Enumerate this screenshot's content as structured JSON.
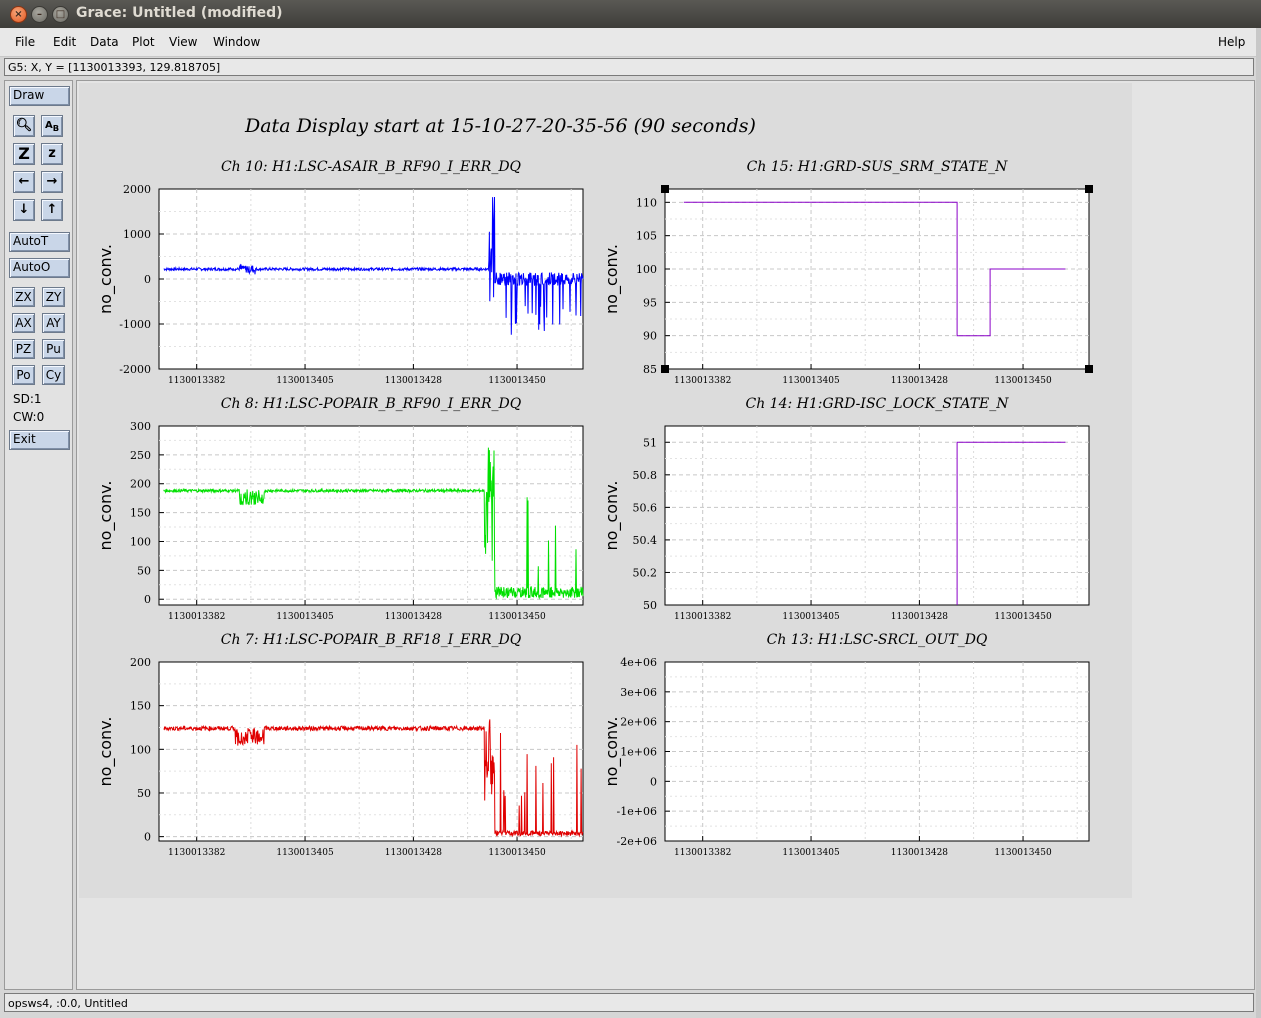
{
  "window": {
    "title": "Grace: Untitled (modified)",
    "close": "×",
    "minimize": "–",
    "maximize": "□"
  },
  "menubar": {
    "file": "File",
    "edit": "Edit",
    "data": "Data",
    "plot": "Plot",
    "view": "View",
    "window": "Window",
    "help": "Help"
  },
  "locator": "G5: X, Y = [1130013393, 129.818705]",
  "toolbar": {
    "draw": "Draw",
    "autot": "AutoT",
    "autoo": "AutoO",
    "zx": "ZX",
    "zy": "ZY",
    "ax": "AX",
    "ay": "AY",
    "pz": "PZ",
    "pu": "Pu",
    "po": "Po",
    "cy": "Cy",
    "sd": "SD:1",
    "cw": "CW:0",
    "exit": "Exit"
  },
  "status": "opsws4, :0.0, Untitled",
  "page_title": "Data Display start at 15-10-27-20-35-56 (90 seconds)",
  "chart_data": [
    {
      "type": "line",
      "title": "Ch 10: H1:LSC-ASAIR_B_RF90_I_ERR_DQ",
      "ylabel": "no_conv.",
      "color": "#0000ff",
      "ylim": [
        -2000,
        2000
      ],
      "yticks": [
        "2000",
        "1000",
        "0",
        "-1000",
        "-2000"
      ],
      "xticks": [
        "1130013382",
        "1130013405",
        "1130013428",
        "1130013450"
      ]
    },
    {
      "type": "line",
      "title": "Ch 15: H1:GRD-SUS_SRM_STATE_N",
      "ylabel": "no_conv.",
      "color": "#8a00c8",
      "ylim": [
        85,
        112
      ],
      "yticks": [
        "110",
        "105",
        "100",
        "95",
        "90",
        "85"
      ],
      "xticks": [
        "1130013382",
        "1130013405",
        "1130013428",
        "1130013450"
      ],
      "x": [
        1130013378,
        1130013436,
        1130013436,
        1130013443,
        1130013443,
        1130013459
      ],
      "y": [
        110,
        110,
        90,
        90,
        100,
        100
      ]
    },
    {
      "type": "line",
      "title": "Ch 8: H1:LSC-POPAIR_B_RF90_I_ERR_DQ",
      "ylabel": "no_conv.",
      "color": "#00e000",
      "ylim": [
        -10,
        300
      ],
      "yticks": [
        "300",
        "250",
        "200",
        "150",
        "100",
        "50",
        "0"
      ],
      "xticks": [
        "1130013382",
        "1130013405",
        "1130013428",
        "1130013450"
      ]
    },
    {
      "type": "line",
      "title": "Ch 14: H1:GRD-ISC_LOCK_STATE_N",
      "ylabel": "no_conv.",
      "color": "#8a00c8",
      "ylim": [
        50,
        51.1
      ],
      "yticks": [
        "51",
        "50.8",
        "50.6",
        "50.4",
        "50.2",
        "50"
      ],
      "xticks": [
        "1130013382",
        "1130013405",
        "1130013428",
        "1130013450"
      ],
      "x": [
        1130013436,
        1130013436,
        1130013459
      ],
      "y": [
        50,
        51,
        51
      ]
    },
    {
      "type": "line",
      "title": "Ch 7: H1:LSC-POPAIR_B_RF18_I_ERR_DQ",
      "ylabel": "no_conv.",
      "color": "#e00000",
      "ylim": [
        -5,
        200
      ],
      "yticks": [
        "200",
        "150",
        "100",
        "50",
        "0"
      ],
      "xticks": [
        "1130013382",
        "1130013405",
        "1130013428",
        "1130013450"
      ]
    },
    {
      "type": "line",
      "title": "Ch 13: H1:LSC-SRCL_OUT_DQ",
      "ylabel": "no_conv.",
      "color": "#f0f000",
      "ylim": [
        -2000000,
        4000000
      ],
      "yticks": [
        "4e+06",
        "3e+06",
        "2e+06",
        "1e+06",
        "0",
        "-1e+06",
        "-2e+06"
      ],
      "xticks": [
        "1130013382",
        "1130013405",
        "1130013428",
        "1130013450"
      ]
    }
  ]
}
